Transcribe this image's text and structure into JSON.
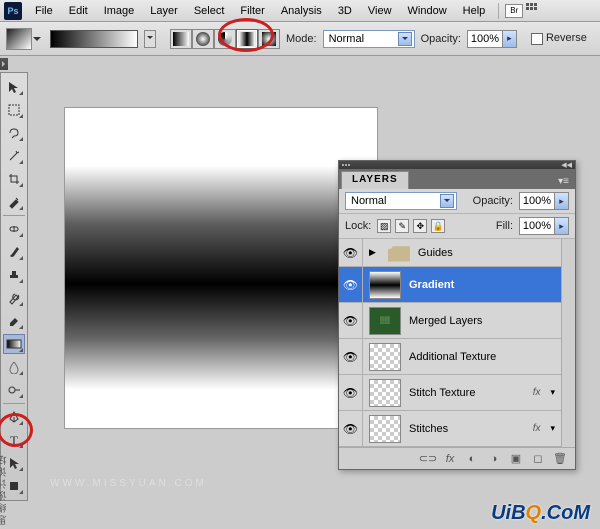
{
  "menu": {
    "items": [
      "File",
      "Edit",
      "Image",
      "Layer",
      "Select",
      "Filter",
      "Analysis",
      "3D",
      "View",
      "Window",
      "Help"
    ],
    "br": "Br"
  },
  "options": {
    "mode_label": "Mode:",
    "mode_value": "Normal",
    "opacity_label": "Opacity:",
    "opacity_value": "100%",
    "reverse_label": "Reverse",
    "gradient_types": [
      "Linear",
      "Radial",
      "Angle",
      "Reflected",
      "Diamond"
    ],
    "gradient_type_selected": "Reflected"
  },
  "panel": {
    "tab": "LAYERS",
    "blend_mode": "Normal",
    "opacity_label": "Opacity:",
    "opacity_value": "100%",
    "lock_label": "Lock:",
    "fill_label": "Fill:",
    "fill_value": "100%",
    "layers": [
      {
        "name": "Guides",
        "type": "group",
        "visible": true
      },
      {
        "name": "Gradient",
        "type": "gradient",
        "visible": true,
        "selected": true
      },
      {
        "name": "Merged Layers",
        "type": "green",
        "visible": true
      },
      {
        "name": "Additional Texture",
        "type": "checker",
        "visible": true
      },
      {
        "name": "Stitch Texture",
        "type": "checker",
        "visible": true,
        "fx": true
      },
      {
        "name": "Stitches",
        "type": "checker",
        "visible": true,
        "fx": true
      }
    ],
    "fx_label": "fx"
  },
  "watermark": "www.missyuan.com",
  "brand": "UiBQ.CoM",
  "cn": "思缘设计论坛"
}
